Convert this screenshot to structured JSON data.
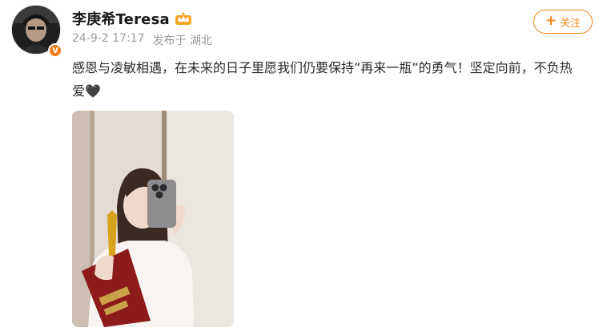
{
  "author": {
    "name": "李庚希Teresa",
    "badge_icon": "crown-icon",
    "verified_icon": "verified-v-icon"
  },
  "meta": {
    "timestamp": "24-9-2 17:17",
    "location": "发布于 湖北"
  },
  "follow_button": {
    "plus": "+",
    "label": "关注"
  },
  "post": {
    "text": "感恩与凌敏相遇，在未来的日子里愿我们仍要保持”再来一瓶”的勇气！坚定向前，不负热爱🖤"
  },
  "colors": {
    "accent": "#f08a1c",
    "meta_gray": "#9a9a9a"
  }
}
